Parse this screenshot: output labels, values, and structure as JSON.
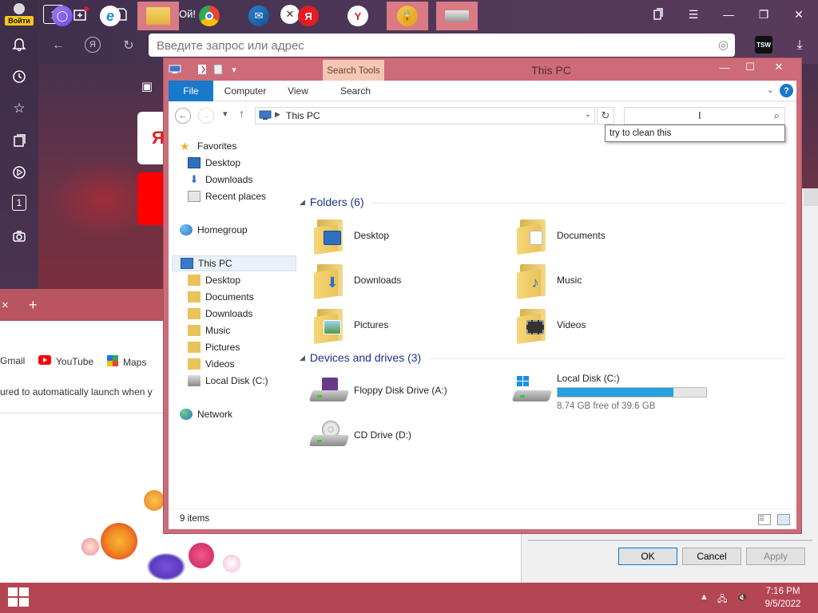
{
  "browser": {
    "profile_label": "Войти",
    "tab_title": "Ой!",
    "tab_counter": "1",
    "address_placeholder": "Введите запрос или адрес",
    "ext_label": "TSW",
    "sidebar_counter": "1",
    "yandex_letter": "Я"
  },
  "browser2": {
    "close": "×",
    "new_tab": "+",
    "bookmarks": [
      {
        "label": "Gmail",
        "icon": "gmail-icon"
      },
      {
        "label": "YouTube",
        "icon": "youtube-icon"
      },
      {
        "label": "Maps",
        "icon": "maps-icon"
      }
    ],
    "notice": "ured to automatically launch when y"
  },
  "dialog": {
    "ok": "OK",
    "cancel": "Cancel",
    "apply": "Apply"
  },
  "explorer": {
    "title": "This PC",
    "context_tab": "Search Tools",
    "ribbon_tabs": [
      "File",
      "Computer",
      "View",
      "Search"
    ],
    "address": "This PC",
    "search_value": "",
    "tooltip": "try to clean this",
    "nav": {
      "favorites": "Favorites",
      "fav_items": [
        "Desktop",
        "Downloads",
        "Recent places"
      ],
      "homegroup": "Homegroup",
      "this_pc": "This PC",
      "pc_items": [
        "Desktop",
        "Documents",
        "Downloads",
        "Music",
        "Pictures",
        "Videos",
        "Local Disk (C:)"
      ],
      "network": "Network"
    },
    "folders_header": "Folders (6)",
    "folders": [
      "Desktop",
      "Documents",
      "Downloads",
      "Music",
      "Pictures",
      "Videos"
    ],
    "drives_header": "Devices and drives (3)",
    "drives": {
      "floppy": "Floppy Disk Drive (A:)",
      "cd": "CD Drive (D:)",
      "local": "Local Disk (C:)",
      "local_free": "8.74 GB free of 39.6 GB",
      "local_used_fraction": 0.78
    },
    "status": "9 items"
  },
  "taskbar": {
    "yandex_letter": "Я",
    "time": "7:16 PM",
    "date": "9/5/2022"
  },
  "colors": {
    "accent": "#1979ca",
    "explorer_frame": "#cd6b78",
    "taskbar": "#b44553",
    "drive_bar": "#26a0da"
  }
}
